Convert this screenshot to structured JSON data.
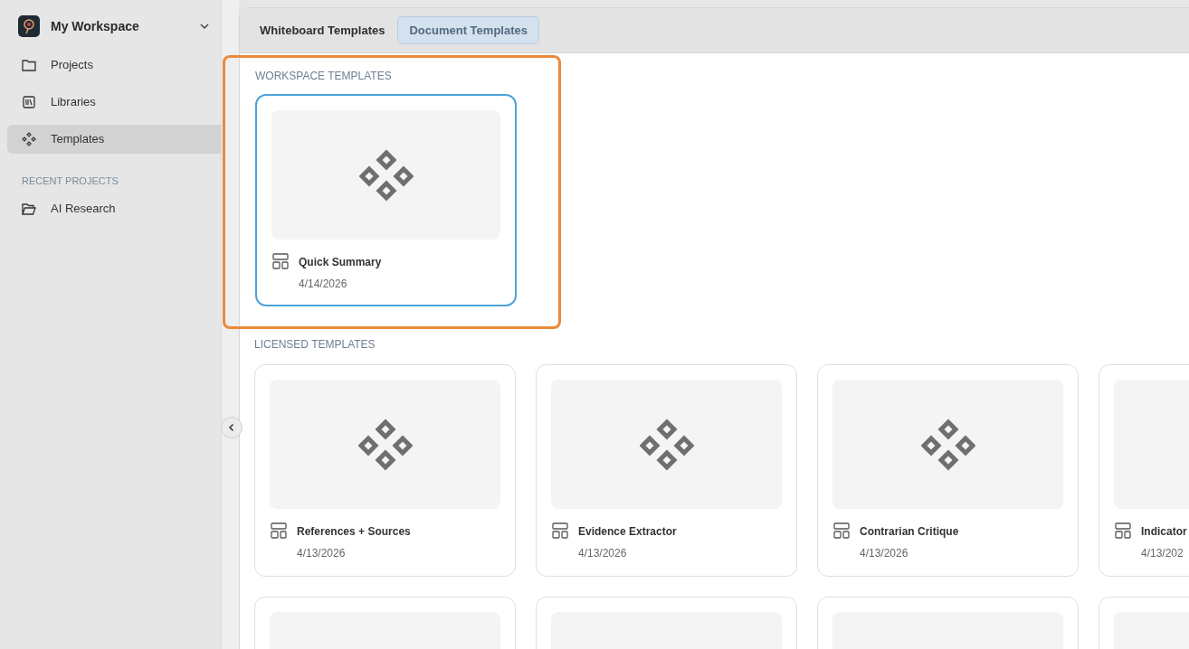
{
  "workspace": {
    "name": "My Workspace"
  },
  "sidebar": {
    "items": [
      {
        "label": "Projects",
        "selected": false
      },
      {
        "label": "Libraries",
        "selected": false
      },
      {
        "label": "Templates",
        "selected": true
      }
    ],
    "recent_heading": "RECENT PROJECTS",
    "recent": [
      {
        "label": "AI Research"
      }
    ]
  },
  "tabs": [
    {
      "label": "Whiteboard Templates",
      "selected": false
    },
    {
      "label": "Document Templates",
      "selected": true
    }
  ],
  "workspace_templates": {
    "heading": "WORKSPACE TEMPLATES",
    "highlighted": true,
    "cards": [
      {
        "kind": "full",
        "title": "Quick Summary",
        "date": "4/14/2026",
        "selected": true
      }
    ]
  },
  "licensed_templates": {
    "heading": "LICENSED TEMPLATES",
    "cards": [
      {
        "kind": "full",
        "title": "References + Sources",
        "date": "4/13/2026",
        "selected": false
      },
      {
        "kind": "full",
        "title": "Evidence Extractor",
        "date": "4/13/2026",
        "selected": false
      },
      {
        "kind": "full",
        "title": "Contrarian Critique",
        "date": "4/13/2026",
        "selected": false
      },
      {
        "kind": "edge",
        "title": "Indicator",
        "date": "4/13/202",
        "selected": false
      },
      {
        "kind": "partial"
      },
      {
        "kind": "partial"
      },
      {
        "kind": "partial"
      },
      {
        "kind": "partial"
      }
    ]
  }
}
